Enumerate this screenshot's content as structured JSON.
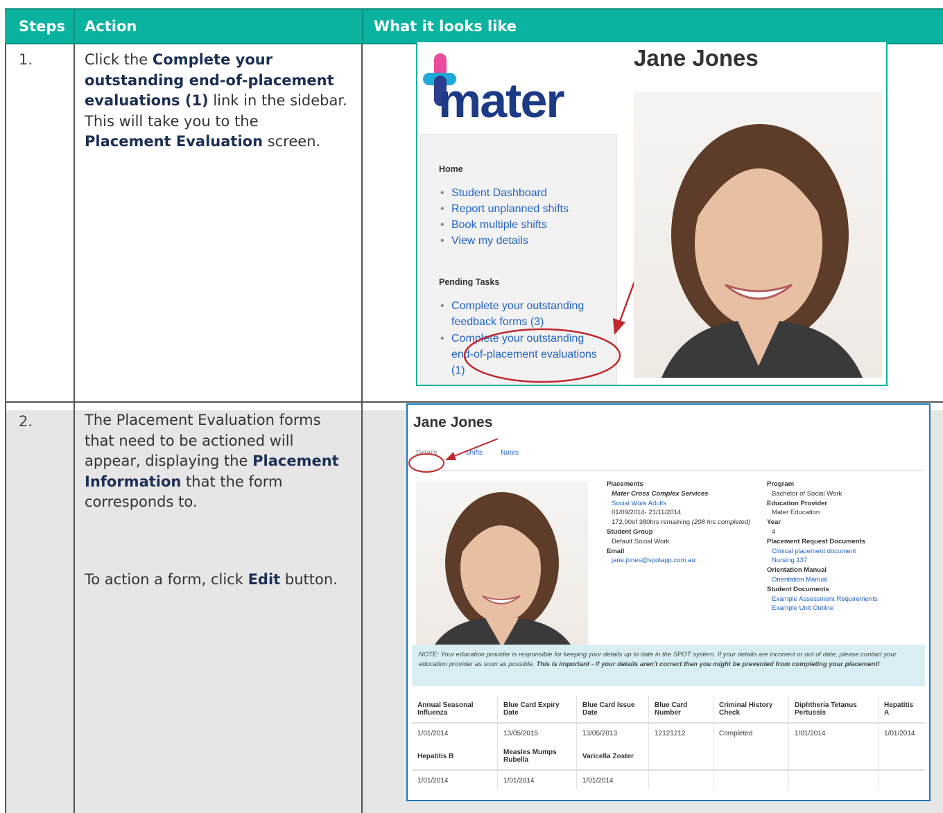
{
  "header": {
    "steps": "Steps",
    "action": "Action",
    "looks": "What it looks like"
  },
  "row1": {
    "step": "1.",
    "text_1": "Click the ",
    "bold_1": "Complete your outstanding end-of-placement evaluations (1)",
    "text_2": " link in the sidebar. This will take you to the ",
    "bold_2": "Placement Evaluation",
    "text_3": " screen."
  },
  "row2": {
    "step": "2.",
    "text_1": " The Placement Evaluation forms that need to be actioned will appear, displaying the ",
    "bold_1": "Placement Information",
    "text_2": " that the form corresponds to.",
    "text_3": "To action a form, click ",
    "bold_2": "Edit",
    "text_4": " button."
  },
  "shot1": {
    "name": "Jane Jones",
    "logo": "mater",
    "home_heading": "Home",
    "home_links": [
      "Student Dashboard",
      "Report unplanned shifts",
      "Book multiple shifts",
      "View my details"
    ],
    "pending_heading": "Pending Tasks",
    "pending_1": "Complete your outstanding feedback forms (3)",
    "pending_2": "Complete your outstanding end-of-placement evaluations (1)"
  },
  "shot2": {
    "name": "Jane Jones",
    "tabs": [
      "Details",
      "Shifts",
      "Notes"
    ],
    "placements_label": "Placements",
    "placement_org": "Mater Cross Complex Services",
    "placement_unit": "Social Work Adults",
    "placement_dates": "01/09/2014- 21/11/2014",
    "placement_hours": "172.00of 380hrs remaining ",
    "placement_hours_done": "(208 hrs completed)",
    "student_group_label": "Student Group",
    "student_group": "Default Social Work",
    "email_label": "Email",
    "email": "jane.jones@spotapp.com.au",
    "program_label": "Program",
    "program": "Bachelor of Social Work",
    "provider_label": "Education Provider",
    "provider": "Mater Education",
    "year_label": "Year",
    "year": "4",
    "request_docs_label": "Placement Request Documents",
    "request_docs": [
      "Clinical placement document",
      "Nursing 137"
    ],
    "orientation_label": "Orientation Manual",
    "orientation": "Orientation Manual",
    "student_docs_label": "Student Documents",
    "student_docs": [
      "Example Assessment Requirements",
      "Example Unit Outline"
    ],
    "note_text": "NOTE: Your education provider is responsible for keeping your details up to date in the SPOT system. If your details are incorrect or out of date, please contact your education provider as soon as possible. ",
    "note_bold": "This is important - if your details aren't correct then you might be prevented from completing your placement!",
    "vax_headers_1": [
      "Annual Seasonal Influenza",
      "Blue Card Expiry Date",
      "Blue Card Issue Date",
      "Blue Card Number",
      "Criminal History Check",
      "Diphtheria Tetanus Pertussis",
      "Hepatitis A"
    ],
    "vax_values_1": [
      "1/01/2014",
      "13/05/2015",
      "13/05/2013",
      "12121212",
      "Completed",
      "1/01/2014",
      "1/01/2014"
    ],
    "vax_headers_2": [
      "Hepatitis B",
      "Measles Mumps Rubella",
      "Varicella Zoster",
      "",
      "",
      "",
      ""
    ],
    "vax_values_2": [
      "1/01/2014",
      "1/01/2014",
      "1/01/2014",
      "",
      "",
      "",
      ""
    ]
  },
  "colors": {
    "header_bg": "#0ab3a0",
    "link": "#2363c5",
    "highlight": "#c0282e"
  }
}
